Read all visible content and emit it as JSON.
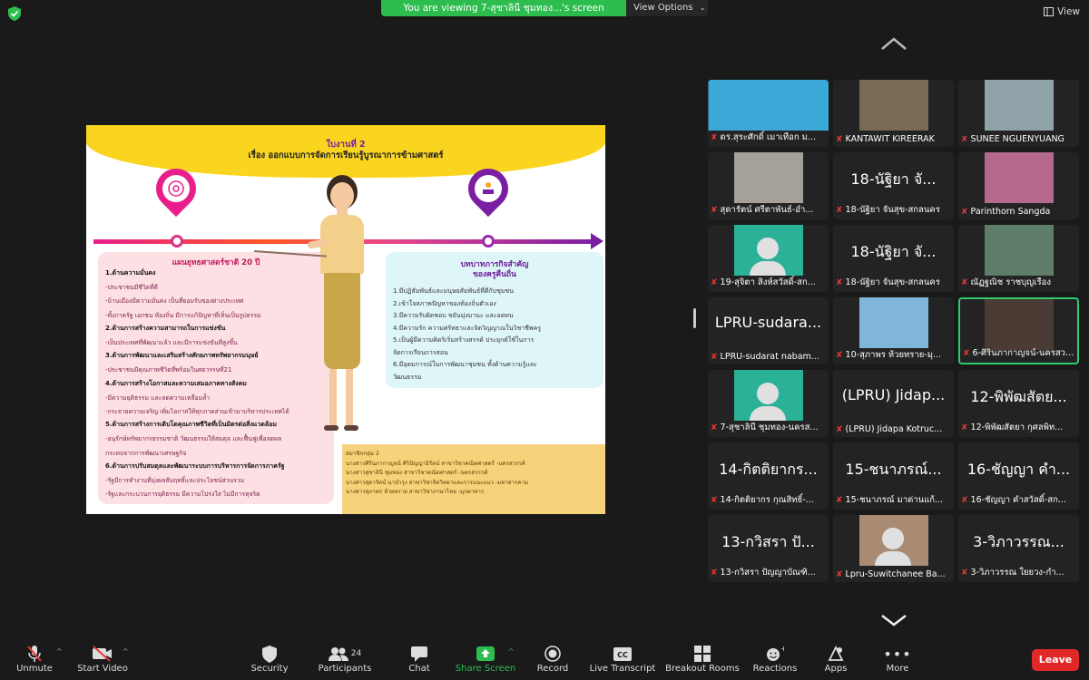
{
  "topbar": {
    "viewing_text": "You are viewing 7-สุชาลินี ชุมทอง...'s screen",
    "view_options": "View Options",
    "view_label": "View"
  },
  "slide": {
    "title1": "ใบงานที่ 2",
    "title2": "เรื่อง ออกแบบการจัดการเรียนรู้บูรณาการข้ามศาสตร์",
    "left_title": "แผนยุทธศาสตร์ชาติ 20 ปี",
    "left_lines": [
      {
        "t": "1.ด้านความมั่นคง",
        "k": "h"
      },
      {
        "t": "-ประชาชนมีชีวิตที่ดี",
        "k": "s"
      },
      {
        "t": "-บ้านเมืองมีความมั่นคง เป็นที่ยอมรับของต่างประเทศ",
        "k": "s"
      },
      {
        "t": "-ทั้งภาครัฐ เอกชน ท้องถิ่น มีการแก้ปัญหาที่เห็นเป็นรูปธรรม",
        "k": "s"
      },
      {
        "t": "2.ด้านการสร้างความสามารถในการแข่งขัน",
        "k": "h"
      },
      {
        "t": "-เป็นประเทศที่พัฒนาแล้ว และมีการแข่งขันที่สูงขึ้น",
        "k": "s"
      },
      {
        "t": "3.ด้านการพัฒนาและเสริมสร้างศักยภาพทรัพยากรมนุษย์",
        "k": "h"
      },
      {
        "t": "-ประชาชนมีคุณภาพชีวิตที่พร้อมในศตวรรษที่21",
        "k": "s"
      },
      {
        "t": "4.ด้านการสร้างโอกาสและความเสมอภาคทางสังคม",
        "k": "h"
      },
      {
        "t": "-มีความยุติธรรม และลดความเหลื่อมล้ำ",
        "k": "s"
      },
      {
        "t": "-กระจายความเจริญ เพิ่มโอกาสให้ทุกภาคส่วนเข้ามาบริหารประเทศได้",
        "k": "s"
      },
      {
        "t": "5.ด้านการสร้างการเติบโตคุณภาพชีวิตที่เป็นมิตรต่อสิ่งแวดล้อม",
        "k": "h"
      },
      {
        "t": "-อนุรักษ์ทรัพยากรธรรมชาติ วัฒนธรรมให้สมดุล และฟื้นฟูเพื่อลดผล",
        "k": "s"
      },
      {
        "t": "กระทบจากการพัฒนาเศรษฐกิจ",
        "k": "s"
      },
      {
        "t": "6.ด้านการปรับสมดุลและพัฒนาระบบการบริหารการจัดการภาครัฐ",
        "k": "h"
      },
      {
        "t": "-รัฐมีการทำงานที่มุ่งผลสัมฤทธิ์และประโยชน์ส่วนรวม",
        "k": "s"
      },
      {
        "t": "-รัฐและกระบวนการยุติธรรม มีความโปร่งใส ไม่มีการทุจริต",
        "k": "s"
      }
    ],
    "right_title1": "บทบาทภารกิจสำคัญ",
    "right_title2": "ของครูคืนถิ่น",
    "right_lines": [
      "1.มีปฏิสัมพันธ์และมนุษยสัมพันธ์ที่ดีกับชุมชน",
      "2.เข้าใจสภาพปัญหาของท้องถิ่นตัวเอง",
      "3.มีความรับผิดชอบ ขยันมุ่งมานะ และอดทน",
      "4.มีความรัก ความศรัทธาและจิตวิญญาณในวิชาชีพครู",
      "5.เป็นผู้มีความคิดริเริ่มสร้างสรรค์ ประยุกต์ใช้ในการ",
      "จัดการเรียนการสอน",
      "6.มีอุดมการณ์ในการพัฒนาชุมชน ทั้งด้านความรู้และ",
      "วัฒนธรรม"
    ],
    "member_lines": [
      "สมาชิกกลุ่ม 2",
      "นางสาวศิรินภากาญจน์ ศิริปัญญาธิรัตน์ สาขาวิชาคณิตศาสตร์ -นครสวรรค์",
      "นางสาวสุชาลินี ชุมทอง สาขาวิชาคณิตศาสตร์ -นครสวรรค์",
      "นางสาวสุดารัตน์ นาบำรุง สาขาวิชาจิตวิทยาและการแนะแนว -มหาสารคาม",
      "นางสาวสุภาพร ห้วยทราย สาขาวิชาภาษาไทย -มุกดาหาร"
    ]
  },
  "gallery": [
    {
      "big": "",
      "label": "ดร.สุระศักดิ์ เมาเทือก ม...",
      "photo": "#3aa9d8",
      "muted": true
    },
    {
      "big": "",
      "label": "KANTAWIT KIREERAK",
      "photo": "#7a6a55",
      "muted": true
    },
    {
      "big": "",
      "label": "SUNEE NGUENYUANG",
      "photo": "#8fa3a9",
      "muted": true
    },
    {
      "big": "",
      "label": "สุดารัตน์ ศรีตาพันธ์-อำ...",
      "photo": "#a5a09a",
      "muted": true
    },
    {
      "big": "18-นัฐิยา จั...",
      "label": "18-นัฐิยา จันสุข-สกลนคร",
      "photo": "",
      "muted": true
    },
    {
      "big": "",
      "label": "Parinthorn Sangda",
      "photo": "#b56a8d",
      "muted": true
    },
    {
      "big": "",
      "label": "19-สุจิตา สิงห์สวัสดิ์-สก...",
      "photo": "#2ab197",
      "muted": true
    },
    {
      "big": "18-นัฐิยา จั...",
      "label": "18-นัฐิยา จันสุข-สกลนคร",
      "photo": "",
      "muted": true
    },
    {
      "big": "",
      "label": "ณัฏฐณิช ราชบุญเรือง",
      "photo": "#5f7e6a",
      "muted": true
    },
    {
      "big": "LPRU-sudara...",
      "label": "LPRU-sudarat nabam...",
      "photo": "",
      "muted": true
    },
    {
      "big": "",
      "label": "10-สุภาพร ห้วยทราย-มุ...",
      "photo": "#7fb6d9",
      "muted": true
    },
    {
      "big": "",
      "label": "6-ศิรินภากาญจน์-นครสวรรค์",
      "photo": "#4a3b35",
      "muted": true
    },
    {
      "big": "",
      "label": "7-สุชาลินี ชุมทอง-นครส...",
      "photo": "#2ab197",
      "muted": true
    },
    {
      "big": "(LPRU) Jidap...",
      "label": "(LPRU) Jidapa Kotruc...",
      "photo": "",
      "muted": true
    },
    {
      "big": "12-พิพัฒสัตย...",
      "label": "12-พิพัฒสัตยา กุศลพิท...",
      "photo": "",
      "muted": true
    },
    {
      "big": "14-กิตติยากร...",
      "label": "14-กิตติยากร กุณสิทธิ์-...",
      "photo": "",
      "muted": true
    },
    {
      "big": "15-ชนาภรณ์...",
      "label": "15-ชนาภรณ์ มาด่านแก้...",
      "photo": "",
      "muted": true
    },
    {
      "big": "16-ชัญญา คำ...",
      "label": "16-ชัญญา คำสวัสดิ์-สก...",
      "photo": "",
      "muted": true
    },
    {
      "big": "13-กวิสรา ปั...",
      "label": "13-กวิสรา ปัญญาบัณฑิ...",
      "photo": "",
      "muted": true
    },
    {
      "big": "",
      "label": "Lpru-Suwitchanee Ba...",
      "photo": "#a98b74",
      "muted": true
    },
    {
      "big": "3-วิภาวรรณ...",
      "label": "3-วิภาวรรณ ใยยวง-กำ...",
      "photo": "",
      "muted": true
    }
  ],
  "toolbar": {
    "unmute": "Unmute",
    "start_video": "Start Video",
    "security": "Security",
    "participants": "Participants",
    "participants_count": "24",
    "chat": "Chat",
    "share_screen": "Share Screen",
    "record": "Record",
    "live_transcript": "Live Transcript",
    "breakout_rooms": "Breakout Rooms",
    "reactions": "Reactions",
    "apps": "Apps",
    "more": "More",
    "leave": "Leave"
  },
  "colors": {
    "banner_green": "#2dbd4e",
    "share_green": "#2dbd4e",
    "leave_red": "#e02828",
    "active_speaker": "#2ecc71"
  }
}
